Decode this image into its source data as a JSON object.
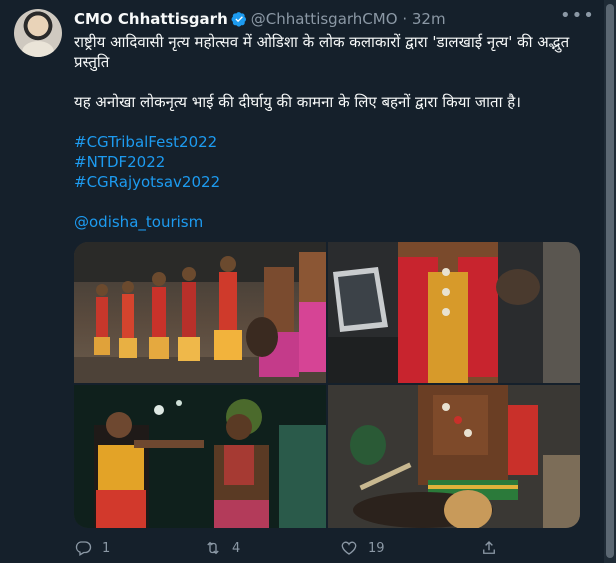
{
  "tweet": {
    "author_name": "CMO Chhattisgarh",
    "handle": "@ChhattisgarhCMO",
    "separator": "·",
    "time": "32m",
    "line1": "राष्ट्रीय आदिवासी नृत्य महोत्सव में ओडिशा के लोक कलाकारों द्वारा 'डालखाई नृत्य' की अद्भुत प्रस्तुति",
    "line2": "यह अनोखा लोकनृत्य भाई की दीर्घायु की कामना के लिए बहनों द्वारा किया जाता है।",
    "hashtags": [
      "#CGTribalFest2022",
      "#NTDF2022",
      "#CGRajyotsav2022"
    ],
    "mention": "@odisha_tourism"
  },
  "actions": {
    "replies": "1",
    "retweets": "4",
    "likes": "19"
  },
  "colors": {
    "background": "#15202b",
    "link": "#1d9bf0",
    "secondary_text": "#8b98a5",
    "verified": "#1d9bf0"
  },
  "icons": [
    "verified-badge-icon",
    "more-icon",
    "reply-icon",
    "retweet-icon",
    "like-icon",
    "share-icon"
  ],
  "photos_count": 4
}
